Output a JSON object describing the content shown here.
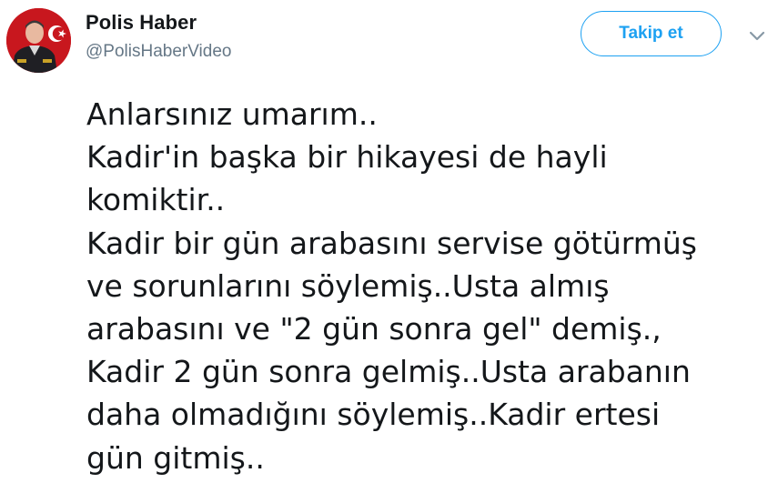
{
  "header": {
    "display_name": "Polis Haber",
    "username": "@PolisHaberVideo",
    "follow_label": "Takip et"
  },
  "icons": {
    "avatar": "police-officer-avatar",
    "more": "chevron-down-icon"
  },
  "tweet": {
    "lines": [
      "Anlarsınız umarım..",
      "Kadir'in başka bir hikayesi de hayli",
      "komiktir..",
      "Kadir bir gün arabasını servise götürmüş",
      "ve sorunlarını söylemiş..Usta almış",
      "arabasını ve \"2 gün sonra gel\" demiş.,",
      "Kadir 2 gün sonra gelmiş..Usta arabanın",
      "daha olmadığını söylemiş..Kadir ertesi",
      "gün gitmiş.."
    ]
  },
  "colors": {
    "accent": "#1da1f2",
    "text": "#14171a",
    "secondary_text": "#657786",
    "avatar_background": "#c8171e"
  }
}
